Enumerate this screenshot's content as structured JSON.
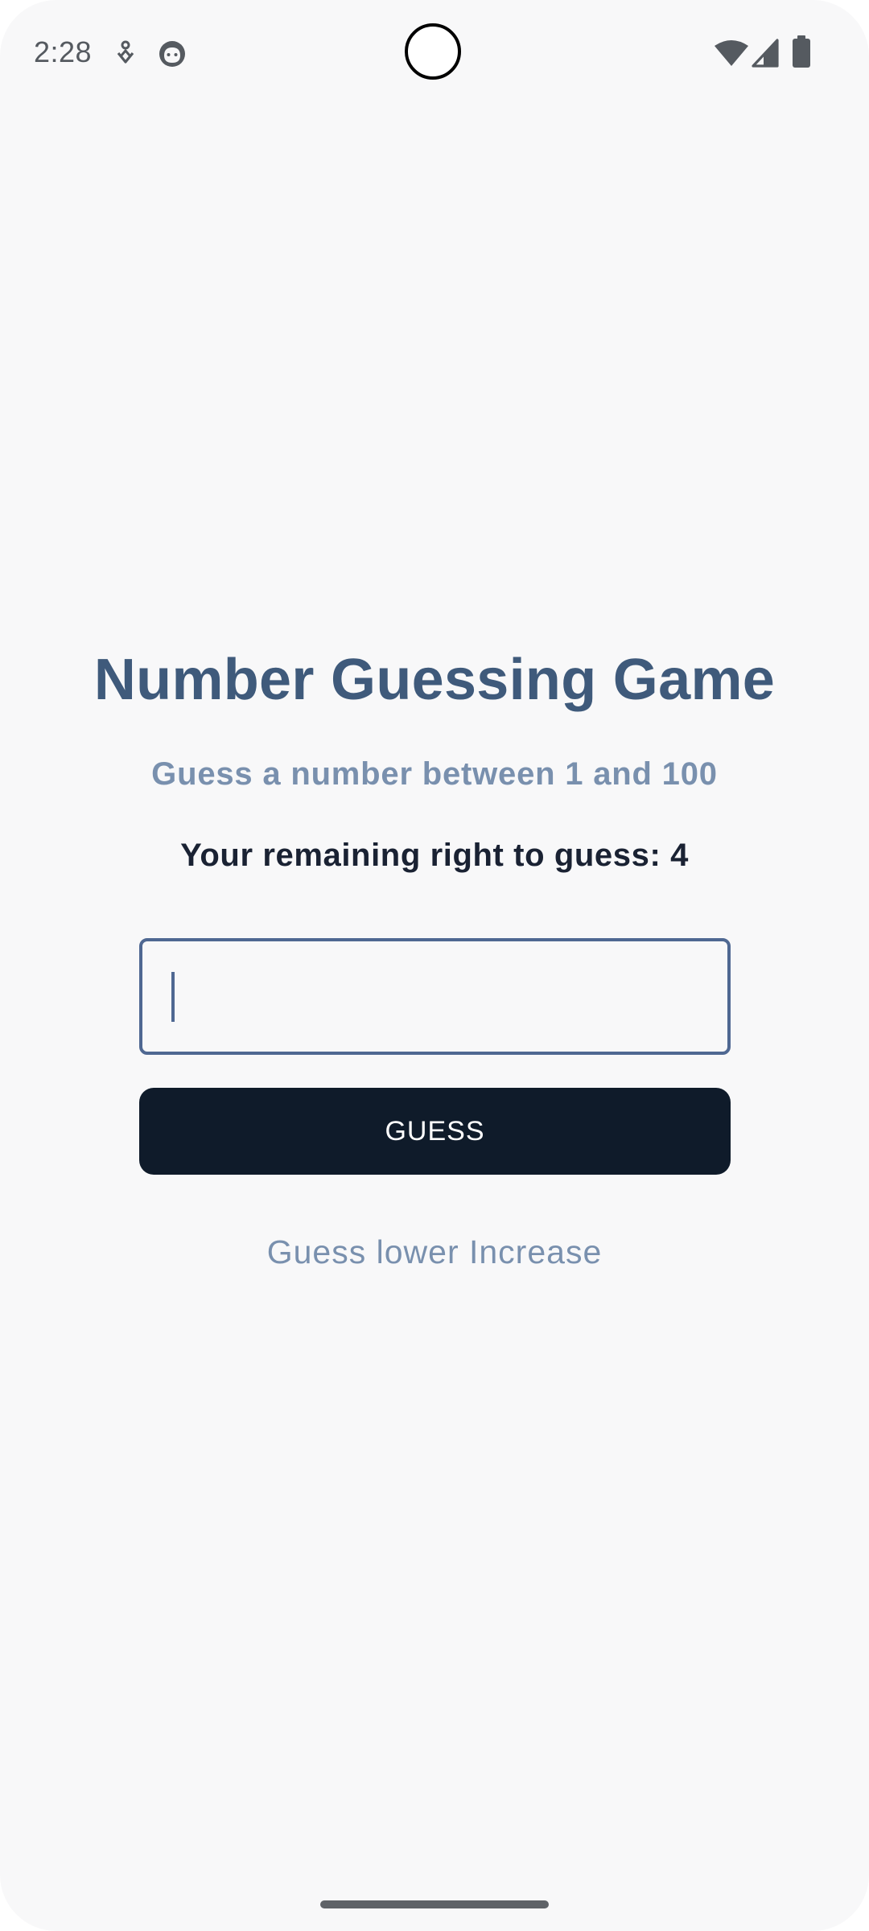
{
  "status_bar": {
    "time": "2:28",
    "icons": [
      "download-icon",
      "face-icon",
      "wifi-icon",
      "signal-icon",
      "battery-icon"
    ]
  },
  "game": {
    "title": "Number Guessing Game",
    "subtitle": "Guess a number between 1 and 100",
    "remaining_text": "Your remaining right to guess: 4",
    "input_value": "",
    "button_label": "GUESS",
    "hint": "Guess lower Increase"
  },
  "colors": {
    "title": "#3f5a7b",
    "subtitle": "#7990ae",
    "body_text": "#1a2233",
    "input_border": "#4f6892",
    "button_bg": "#0f1b2a",
    "background": "#f8f8f9"
  }
}
